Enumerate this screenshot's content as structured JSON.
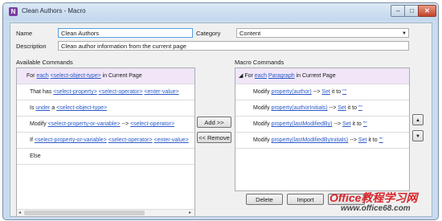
{
  "window": {
    "title": "Clean Authors - Macro",
    "app_icon_letter": "N",
    "min_glyph": "–",
    "max_glyph": "□",
    "close_glyph": "✕"
  },
  "form": {
    "name_label": "Name",
    "name_value": "Clean Authors",
    "category_label": "Category",
    "category_value": "Content",
    "description_label": "Description",
    "description_value": "Clean author information from the current page"
  },
  "available": {
    "label": "Available Commands",
    "rows": [
      [
        {
          "t": "For "
        },
        {
          "t": "each",
          "l": true
        },
        {
          "t": " "
        },
        {
          "t": "<select-object-type>",
          "l": true
        },
        {
          "t": " in Current Page"
        }
      ],
      [
        {
          "t": "That has "
        },
        {
          "t": "<select-property>",
          "l": true
        },
        {
          "t": " "
        },
        {
          "t": "<select-operator>",
          "l": true
        },
        {
          "t": " "
        },
        {
          "t": "<enter-value>",
          "l": true
        }
      ],
      [
        {
          "t": "Is "
        },
        {
          "t": "under",
          "l": true
        },
        {
          "t": " a "
        },
        {
          "t": "<select-object-type>",
          "l": true
        }
      ],
      [
        {
          "t": "Modify "
        },
        {
          "t": "<select-property-or-variable>",
          "l": true
        },
        {
          "t": " --> "
        },
        {
          "t": "<select-operator>",
          "l": true
        }
      ],
      [
        {
          "t": "If "
        },
        {
          "t": "<select-property-or-variable>",
          "l": true
        },
        {
          "t": " "
        },
        {
          "t": "<select-operator>",
          "l": true
        },
        {
          "t": " "
        },
        {
          "t": "<enter-value>",
          "l": true
        }
      ],
      [
        {
          "t": "Else"
        }
      ]
    ]
  },
  "macro": {
    "label": "Macro Commands",
    "rows": [
      [
        {
          "t": "◢ For "
        },
        {
          "t": "each",
          "l": true
        },
        {
          "t": " "
        },
        {
          "t": "Paragraph",
          "l": true
        },
        {
          "t": " in Current Page"
        }
      ],
      [
        {
          "t": "Modify "
        },
        {
          "t": "property(author)",
          "l": true
        },
        {
          "t": " --> "
        },
        {
          "t": "Set",
          "l": true
        },
        {
          "t": " it to "
        },
        {
          "t": "\"\"",
          "l": true
        }
      ],
      [
        {
          "t": "Modify "
        },
        {
          "t": "property(authorInitials)",
          "l": true
        },
        {
          "t": " --> "
        },
        {
          "t": "Set",
          "l": true
        },
        {
          "t": " it to "
        },
        {
          "t": "\"\"",
          "l": true
        }
      ],
      [
        {
          "t": "Modify "
        },
        {
          "t": "property(lastModifiedBy)",
          "l": true
        },
        {
          "t": " --> "
        },
        {
          "t": "Set",
          "l": true
        },
        {
          "t": " it to "
        },
        {
          "t": "\"\"",
          "l": true
        }
      ],
      [
        {
          "t": "Modify "
        },
        {
          "t": "property(lastModifiedByInitials)",
          "l": true
        },
        {
          "t": " --> "
        },
        {
          "t": "Set",
          "l": true
        },
        {
          "t": " it to "
        },
        {
          "t": "\"\"",
          "l": true
        }
      ]
    ]
  },
  "buttons": {
    "add": "Add >>",
    "remove": "<< Remove",
    "up": "▲",
    "down": "▼",
    "delete": "Delete",
    "import": "Import"
  },
  "scroll": {
    "left": "◂",
    "right": "▸"
  },
  "watermark": {
    "line1": "Office教程学习网",
    "line2": "www.office68.com"
  }
}
